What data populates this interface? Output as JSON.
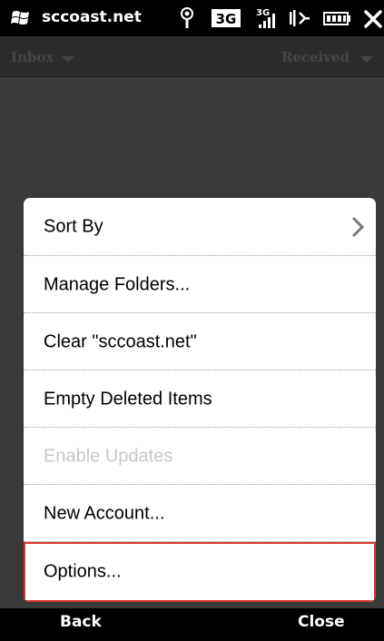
{
  "titlebar": {
    "title": "sccoast.net",
    "icons": [
      "windows-flag-icon",
      "antenna-icon",
      "3g-icon",
      "3g-signal-icon",
      "speaker-icon",
      "battery-icon",
      "close-icon"
    ]
  },
  "inbox": {
    "folder_label": "Inbox",
    "sort_label": "Received"
  },
  "menu": {
    "items": [
      {
        "label": "Sort By",
        "enabled": true,
        "submenu": true
      },
      {
        "label": "Manage Folders...",
        "enabled": true
      },
      {
        "label": "Clear \"sccoast.net\"",
        "enabled": true
      },
      {
        "label": "Empty Deleted Items",
        "enabled": true
      },
      {
        "label": "Enable Updates",
        "enabled": false
      },
      {
        "label": "New Account...",
        "enabled": true
      },
      {
        "label": "Options...",
        "enabled": true,
        "highlighted": true
      }
    ]
  },
  "softkeys": {
    "left": "Back",
    "right": "Close"
  },
  "colors": {
    "highlight_border": "#d9342b",
    "disabled_text": "#c8c8c8",
    "menu_background": "#ffffff",
    "dimmed_background": "#3a3a3a"
  }
}
